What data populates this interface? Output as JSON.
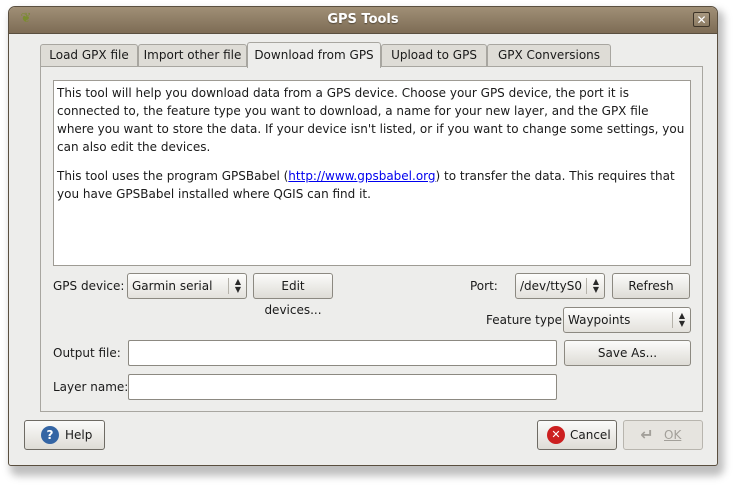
{
  "window": {
    "title": "GPS Tools",
    "close_glyph": "✕",
    "app_icon": "qgis-icon"
  },
  "tabs": [
    {
      "label": "Load GPX file",
      "active": false
    },
    {
      "label": "Import other file",
      "active": false
    },
    {
      "label": "Download from GPS",
      "active": true
    },
    {
      "label": "Upload to GPS",
      "active": false
    },
    {
      "label": "GPX Conversions",
      "active": false
    }
  ],
  "info": {
    "para1": "This tool will help you download data from a GPS device. Choose your GPS device, the port it is connected to, the feature type you want to download, a name for your new layer, and the GPX file where you want to store the data. If your device isn't listed, or if you want to change some settings, you can also edit the devices.",
    "para2_before": "This tool uses the program GPSBabel (",
    "para2_link": "http://www.gpsbabel.org",
    "para2_after": ") to transfer the data. This requires that you have GPSBabel installed where QGIS can find it."
  },
  "form": {
    "gps_device_label": "GPS device:",
    "gps_device_value": "Garmin serial",
    "edit_devices_label": "Edit devices...",
    "port_label": "Port:",
    "port_value": "/dev/ttyS0",
    "refresh_label": "Refresh",
    "feature_type_label": "Feature type:",
    "feature_type_value": "Waypoints",
    "output_file_label": "Output file:",
    "output_file_value": "",
    "save_as_label": "Save As...",
    "layer_name_label": "Layer name:",
    "layer_name_value": ""
  },
  "buttons": {
    "help_label": "Help",
    "help_icon_glyph": "?",
    "cancel_label": "Cancel",
    "cancel_icon_glyph": "✕",
    "ok_label": "OK",
    "ok_icon_glyph": "↵",
    "ok_enabled": false
  },
  "colors": {
    "title_bar": "#8b7a62",
    "help_icon": "#3465a4",
    "cancel_icon": "#cc1f1f",
    "link": "#0000ee"
  }
}
